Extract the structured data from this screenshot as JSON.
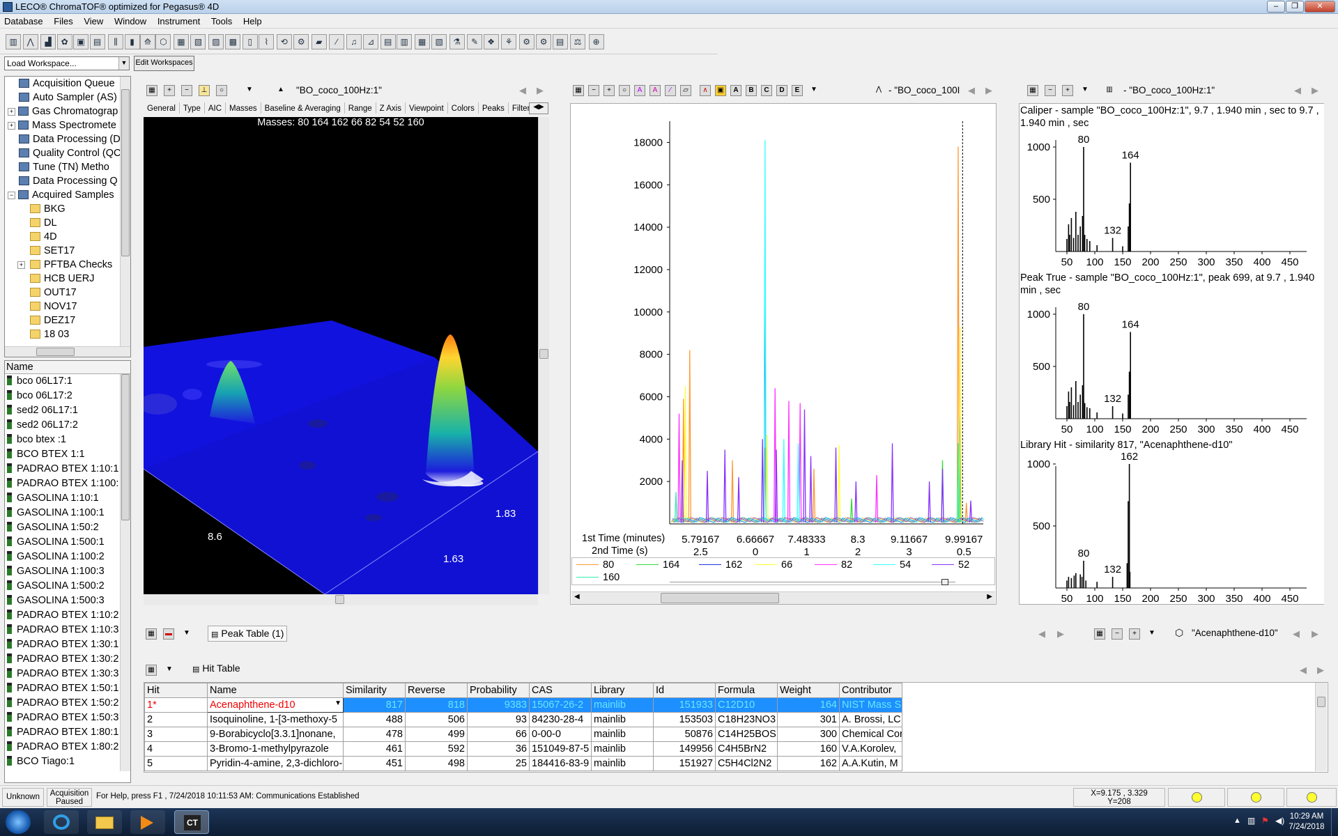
{
  "window": {
    "title": "LECO® ChromaTOF® optimized for Pegasus® 4D"
  },
  "menu": [
    "Database",
    "Files",
    "View",
    "Window",
    "Instrument",
    "Tools",
    "Help"
  ],
  "workspace": {
    "combo_value": "Load Workspace...",
    "edit_button": "Edit Workspaces"
  },
  "tree": [
    {
      "label": "Acquisition Queue",
      "icon": "queue-icon",
      "exp": ""
    },
    {
      "label": "Auto Sampler (AS)",
      "icon": "autosampler-icon",
      "exp": ""
    },
    {
      "label": "Gas Chromatograp",
      "icon": "gc-icon",
      "exp": "+"
    },
    {
      "label": "Mass Spectromete",
      "icon": "ms-icon",
      "exp": "+"
    },
    {
      "label": "Data Processing (D",
      "icon": "processing-icon",
      "exp": ""
    },
    {
      "label": "Quality Control (QC",
      "icon": "qc-icon",
      "exp": ""
    },
    {
      "label": "Tune (TN) Metho",
      "icon": "tune-icon",
      "exp": ""
    },
    {
      "label": "Data Processing Q",
      "icon": "processing-queue-icon",
      "exp": ""
    },
    {
      "label": "Acquired Samples",
      "icon": "samples-icon",
      "exp": "−"
    }
  ],
  "folders": [
    "BKG",
    "DL",
    "4D",
    "SET17",
    "PFTBA Checks",
    "HCB UERJ",
    "OUT17",
    "NOV17",
    "DEZ17",
    "18 03"
  ],
  "sample_list": {
    "header": "Name",
    "items": [
      "bco 06L17:1",
      "bco 06L17:2",
      "sed2 06L17:1",
      "sed2 06L17:2",
      "bco btex :1",
      "BCO BTEX 1:1",
      "PADRAO BTEX 1:10:1",
      "PADRAO BTEX 1:100:",
      "GASOLINA 1:10:1",
      "GASOLINA 1:100:1",
      "GASOLINA 1:50:2",
      "GASOLINA 1:500:1",
      "GASOLINA 1:100:2",
      "GASOLINA 1:100:3",
      "GASOLINA 1:500:2",
      "GASOLINA 1:500:3",
      "PADRAO BTEX 1:10:2",
      "PADRAO BTEX 1:10:3",
      "PADRAO BTEX 1:30:1",
      "PADRAO BTEX 1:30:2",
      "PADRAO BTEX 1:30:3",
      "PADRAO BTEX 1:50:1",
      "PADRAO BTEX 1:50:2",
      "PADRAO BTEX 1:50:3",
      "PADRAO BTEX 1:80:1",
      "PADRAO BTEX 1:80:2",
      "BCO Tiago:1"
    ]
  },
  "surface_view": {
    "sample": "\"BO_coco_100Hz:1\"",
    "tabs": [
      "General",
      "Type",
      "AIC",
      "Masses",
      "Baseline & Averaging",
      "Range",
      "Z Axis",
      "Viewpoint",
      "Colors",
      "Peaks",
      "Filter"
    ],
    "masses_caption": "Masses:  80 164 162 66 82 54 52 160",
    "axis_labels": [
      "8.6",
      "1.83",
      "1.63"
    ]
  },
  "chromatogram": {
    "sample": "- \"BO_coco_100I",
    "row1_label": "1st Time (minutes)",
    "row2_label": "2nd Time (s)",
    "row1_ticks": [
      "5.79167",
      "6.66667",
      "7.48333",
      "8.3",
      "9.11667",
      "9.99167"
    ],
    "row2_ticks": [
      "2.5",
      "0",
      "1",
      "2",
      "3",
      "0.5"
    ],
    "icon_letters": [
      "A",
      "B",
      "C",
      "D",
      "E"
    ]
  },
  "chart_data": {
    "type": "line",
    "title": "",
    "xlabel": "1st Time (minutes)",
    "ylabel": "",
    "ylim": [
      0,
      19000
    ],
    "yticks": [
      2000,
      4000,
      6000,
      8000,
      10000,
      12000,
      14000,
      16000,
      18000
    ],
    "xlim": [
      5.3,
      10.3
    ],
    "marker_x": 9.97,
    "series": [
      {
        "name": "80",
        "color": "#ff9933",
        "peaks": [
          [
            5.52,
            5900
          ],
          [
            5.62,
            8200
          ],
          [
            6.3,
            3000
          ],
          [
            6.82,
            3600
          ],
          [
            7.6,
            2600
          ],
          [
            9.9,
            17800
          ],
          [
            10.03,
            1000
          ]
        ]
      },
      {
        "name": "164",
        "color": "#33dd33",
        "peaks": [
          [
            8.2,
            1200
          ],
          [
            9.65,
            3000
          ],
          [
            9.92,
            5000
          ]
        ]
      },
      {
        "name": "162",
        "color": "#2233dd",
        "peaks": [
          [
            6.82,
            12300
          ],
          [
            9.93,
            7300
          ]
        ]
      },
      {
        "name": "66",
        "color": "#ffff33",
        "peaks": [
          [
            5.55,
            6500
          ],
          [
            6.85,
            4200
          ],
          [
            8.0,
            3700
          ],
          [
            9.93,
            9300
          ]
        ]
      },
      {
        "name": "82",
        "color": "#ff33ff",
        "peaks": [
          [
            5.45,
            5200
          ],
          [
            6.98,
            6400
          ],
          [
            7.2,
            5800
          ],
          [
            7.38,
            5700
          ],
          [
            8.6,
            2300
          ]
        ]
      },
      {
        "name": "54",
        "color": "#33ffff",
        "peaks": [
          [
            6.82,
            18100
          ],
          [
            7.12,
            4000
          ],
          [
            7.35,
            3800
          ]
        ]
      },
      {
        "name": "52",
        "color": "#8833ff",
        "peaks": [
          [
            5.5,
            3000
          ],
          [
            5.9,
            2500
          ],
          [
            6.18,
            3500
          ],
          [
            6.4,
            2200
          ],
          [
            6.78,
            4000
          ],
          [
            7.0,
            3500
          ],
          [
            7.45,
            5400
          ],
          [
            7.55,
            3200
          ],
          [
            7.95,
            3600
          ],
          [
            8.27,
            2000
          ],
          [
            8.85,
            3800
          ],
          [
            9.44,
            2000
          ],
          [
            9.65,
            2600
          ],
          [
            10.1,
            1100
          ]
        ]
      },
      {
        "name": "160",
        "color": "#33eeaa",
        "peaks": [
          [
            5.4,
            1500
          ],
          [
            9.9,
            3800
          ]
        ]
      }
    ]
  },
  "spectra": {
    "sample": "- \"BO_coco_100Hz:1\"",
    "xticks": [
      "50",
      "100",
      "150",
      "200",
      "250",
      "300",
      "350",
      "400",
      "450"
    ],
    "yticks": [
      "1000",
      "500"
    ],
    "panels": [
      {
        "title": "Caliper - sample \"BO_coco_100Hz:1\", 9.7 , 1.940 min , sec to 9.7 , 1.940 min , sec",
        "labels": [
          {
            "mz": 80,
            "text": "80"
          },
          {
            "mz": 164,
            "text": "164"
          },
          {
            "mz": 132,
            "text": "132"
          }
        ],
        "peaks": [
          [
            50,
            120
          ],
          [
            53,
            260
          ],
          [
            55,
            160
          ],
          [
            58,
            320
          ],
          [
            62,
            130
          ],
          [
            66,
            380
          ],
          [
            70,
            160
          ],
          [
            74,
            240
          ],
          [
            78,
            340
          ],
          [
            80,
            1000
          ],
          [
            82,
            160
          ],
          [
            86,
            120
          ],
          [
            91,
            100
          ],
          [
            104,
            60
          ],
          [
            132,
            130
          ],
          [
            150,
            50
          ],
          [
            160,
            240
          ],
          [
            162,
            460
          ],
          [
            164,
            850
          ]
        ]
      },
      {
        "title": "Peak True - sample \"BO_coco_100Hz:1\", peak 699, at 9.7 , 1.940 min , sec",
        "labels": [
          {
            "mz": 80,
            "text": "80"
          },
          {
            "mz": 164,
            "text": "164"
          },
          {
            "mz": 132,
            "text": "132"
          }
        ],
        "peaks": [
          [
            50,
            120
          ],
          [
            53,
            260
          ],
          [
            55,
            160
          ],
          [
            58,
            300
          ],
          [
            62,
            130
          ],
          [
            66,
            360
          ],
          [
            70,
            160
          ],
          [
            74,
            230
          ],
          [
            78,
            320
          ],
          [
            80,
            1000
          ],
          [
            82,
            150
          ],
          [
            86,
            110
          ],
          [
            91,
            100
          ],
          [
            104,
            60
          ],
          [
            132,
            120
          ],
          [
            150,
            50
          ],
          [
            160,
            230
          ],
          [
            162,
            450
          ],
          [
            164,
            830
          ]
        ]
      },
      {
        "title": "Library Hit - similarity 817, \"Acenaphthene-d10\"",
        "labels": [
          {
            "mz": 162,
            "text": "162"
          },
          {
            "mz": 80,
            "text": "80"
          },
          {
            "mz": 132,
            "text": "132"
          }
        ],
        "peaks": [
          [
            50,
            60
          ],
          [
            53,
            90
          ],
          [
            58,
            80
          ],
          [
            63,
            100
          ],
          [
            66,
            120
          ],
          [
            74,
            110
          ],
          [
            77,
            90
          ],
          [
            80,
            220
          ],
          [
            84,
            60
          ],
          [
            104,
            50
          ],
          [
            132,
            90
          ],
          [
            158,
            200
          ],
          [
            160,
            700
          ],
          [
            162,
            1000
          ],
          [
            163,
            130
          ]
        ]
      }
    ]
  },
  "peak_table": {
    "tab": "Peak Table (1)",
    "compound": "\"Acenaphthene-d10\""
  },
  "hit_table": {
    "tab": "Hit Table",
    "columns": [
      "Hit",
      "Name",
      "Similarity",
      "Reverse",
      "Probability",
      "CAS",
      "Library",
      "Id",
      "Formula",
      "Weight",
      "Contributor"
    ],
    "rows": [
      [
        "1*",
        "Acenaphthene-d10",
        "817",
        "818",
        "9383",
        "15067-26-2",
        "mainlib",
        "151933",
        "C12D10",
        "164",
        "NIST Mass S"
      ],
      [
        "2",
        "Isoquinoline, 1-[3-methoxy-5",
        "488",
        "506",
        "93",
        "84230-28-4",
        "mainlib",
        "153503",
        "C18H23NO3",
        "301",
        "A. Brossi, LC"
      ],
      [
        "3",
        "9-Borabicyclo[3.3.1]nonane,",
        "478",
        "499",
        "66",
        "0-00-0",
        "mainlib",
        "50876",
        "C14H25BOS",
        "300",
        "Chemical Cor"
      ],
      [
        "4",
        "3-Bromo-1-methylpyrazole",
        "461",
        "592",
        "36",
        "151049-87-5",
        "mainlib",
        "149956",
        "C4H5BrN2",
        "160",
        "V.A.Korolev,"
      ],
      [
        "5",
        "Pyridin-4-amine, 2,3-dichloro-",
        "451",
        "498",
        "25",
        "184416-83-9",
        "mainlib",
        "151927",
        "C5H4Cl2N2",
        "162",
        "A.A.Kutin, M"
      ]
    ]
  },
  "status": {
    "mode": "Unknown",
    "acq_line1": "Acquisition",
    "acq_line2": "Paused",
    "message": "For Help, press F1 , 7/24/2018 10:11:53 AM: Communications Established",
    "coord_line1": "X=9.175 , 3.329",
    "coord_line2": "Y=208"
  },
  "taskbar": {
    "time": "10:29 AM",
    "date": "7/24/2018"
  },
  "colors": {
    "surface": "#1010dd",
    "titlebar": "#c3d7ee",
    "selection": "#1e8fff"
  }
}
